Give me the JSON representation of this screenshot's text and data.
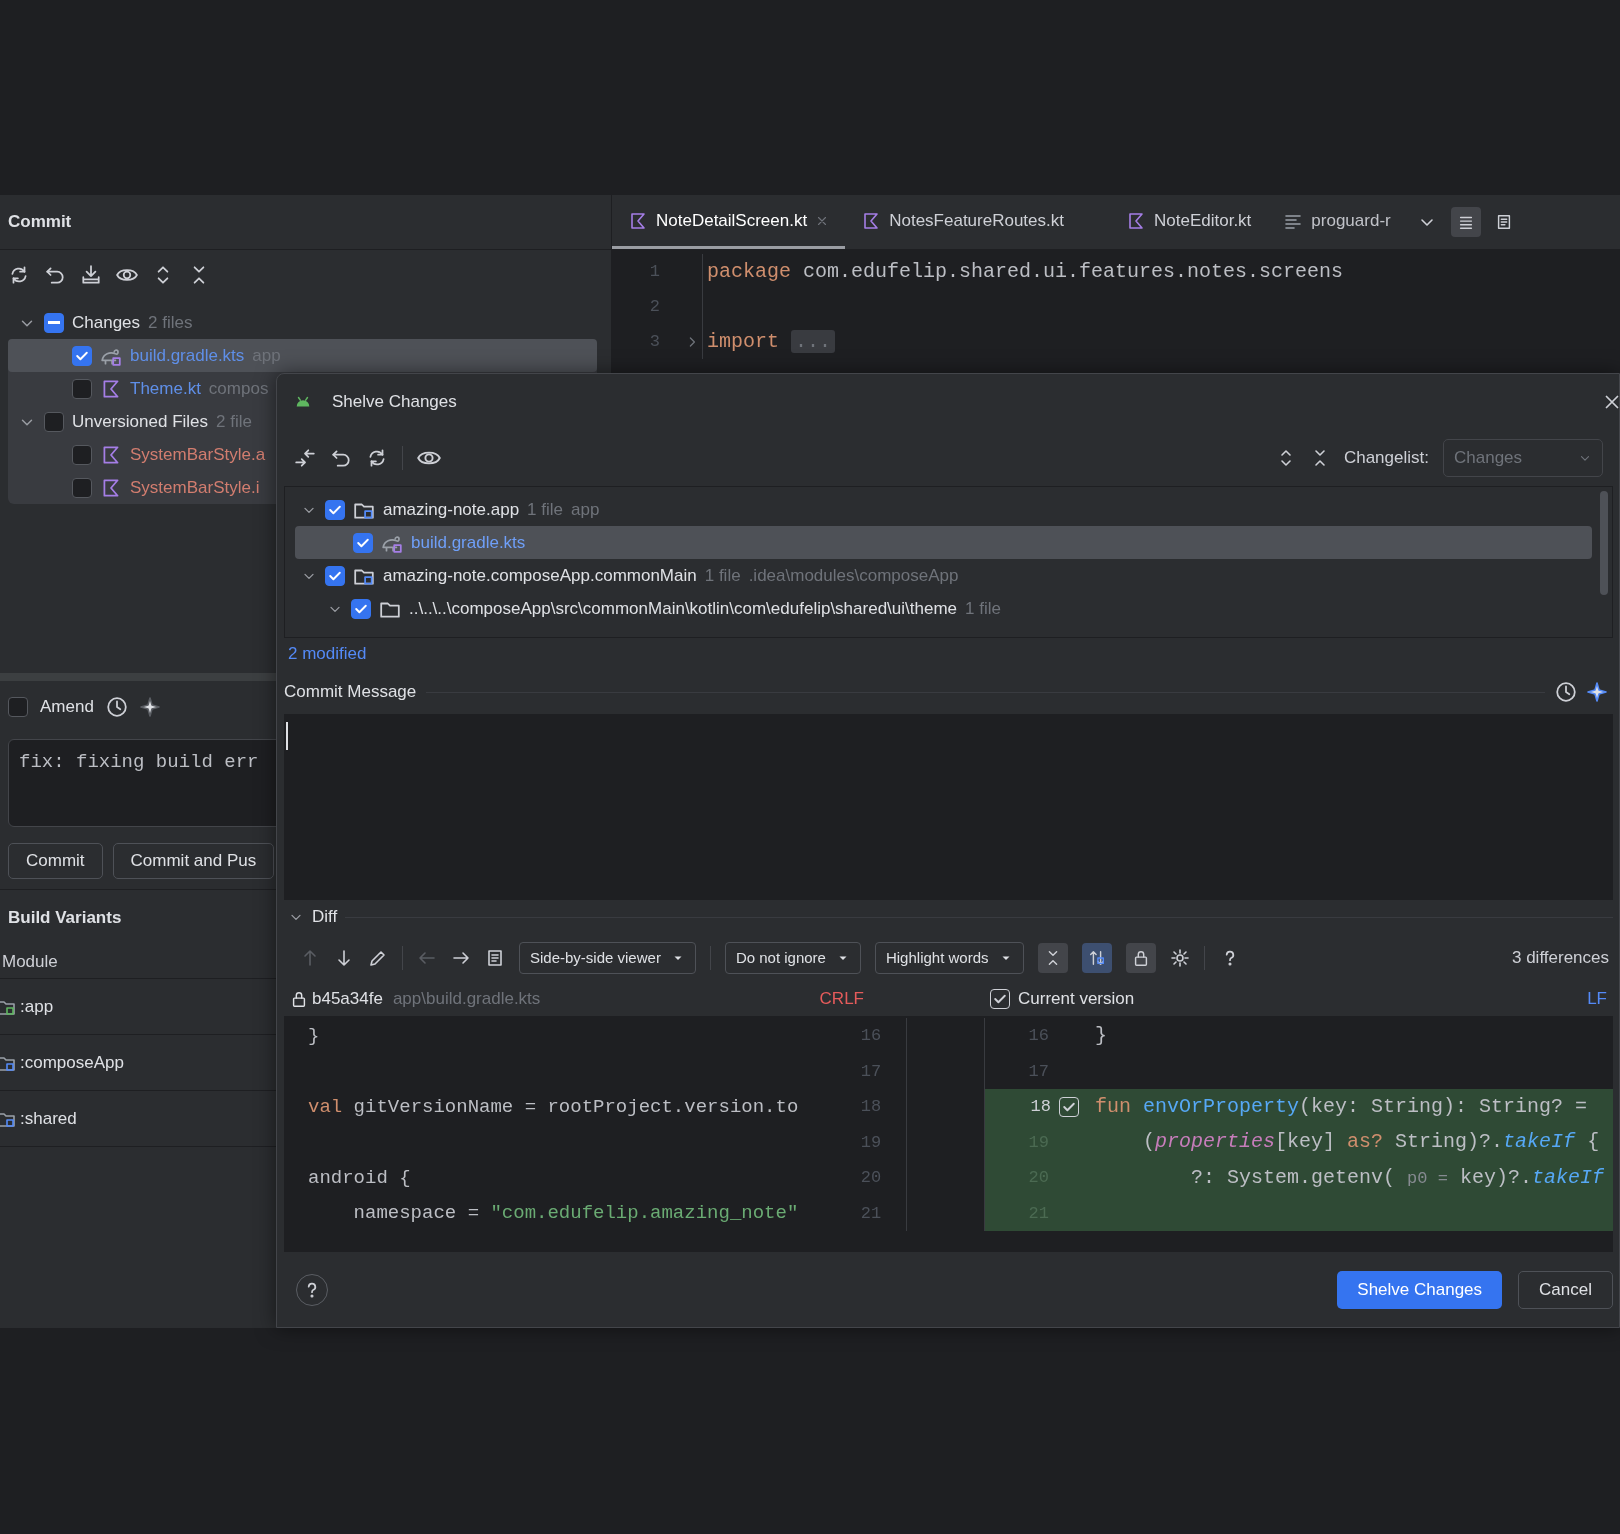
{
  "commit_panel": {
    "title": "Commit",
    "tree": [
      {
        "kind": "group",
        "label": "Changes",
        "meta": "2 files",
        "checked": false,
        "indeterminate": true,
        "selected": false,
        "children": [
          {
            "kind": "gradle-file",
            "label": "build.gradle.kts",
            "meta": "app",
            "color": "#5f8fe8",
            "checked": true,
            "indeterminate": false,
            "selected": true
          },
          {
            "kind": "kotlin-file",
            "label": "Theme.kt",
            "meta": "compos",
            "color": "#5f8fe8",
            "checked": false,
            "indeterminate": false,
            "selected": false
          }
        ]
      },
      {
        "kind": "group",
        "label": "Unversioned Files",
        "meta": "2 file",
        "checked": false,
        "indeterminate": false,
        "selected": false,
        "children": [
          {
            "kind": "kotlin-file",
            "label": "SystemBarStyle.a",
            "color": "#d27d6f",
            "checked": false,
            "indeterminate": false,
            "selected": false
          },
          {
            "kind": "kotlin-file",
            "label": "SystemBarStyle.i",
            "color": "#d27d6f",
            "checked": false,
            "indeterminate": false,
            "selected": false
          }
        ]
      }
    ],
    "amend": {
      "label": "Amend",
      "checked": false
    },
    "message": "fix: fixing build err",
    "buttons": [
      "Commit",
      "Commit and Pus"
    ]
  },
  "build_variants": {
    "title": "Build Variants",
    "column": "Module",
    "modules": [
      {
        "name": ":app",
        "kind": "application"
      },
      {
        "name": ":composeApp",
        "kind": "library"
      },
      {
        "name": ":shared",
        "kind": "library"
      }
    ]
  },
  "editor": {
    "tabs": [
      {
        "label": "NoteDetailScreen.kt",
        "kind": "kotlin",
        "selected": true,
        "closable": true
      },
      {
        "label": "NotesFeatureRoutes.kt",
        "kind": "kotlin",
        "selected": false,
        "closable": false
      },
      {
        "label": "NoteEditor.kt",
        "kind": "kotlin",
        "selected": false,
        "closable": false
      },
      {
        "label": "proguard-r",
        "kind": "text",
        "selected": false,
        "closable": false
      }
    ],
    "lines": [
      {
        "number": "1",
        "folded": false,
        "segments": [
          {
            "kind": "keyword",
            "text": "package"
          },
          {
            "kind": "plain",
            "text": " com.edufelip.shared.ui.features.notes.screens"
          }
        ]
      },
      {
        "number": "2",
        "folded": false
      },
      {
        "number": "3",
        "folded": true,
        "segments": [
          {
            "kind": "keyword",
            "text": "import"
          },
          {
            "kind": "fold",
            "text": "..."
          }
        ]
      }
    ]
  },
  "dialog": {
    "title": "Shelve Changes",
    "changelist_label": "Changelist:",
    "changelist": {
      "value": "Changes",
      "disabled": true
    },
    "tree": [
      {
        "kind": "module",
        "label": "amazing-note.app",
        "count": "1 file",
        "path": "app",
        "checked": true,
        "selected": false,
        "children": [
          {
            "kind": "gradle-file",
            "label": "build.gradle.kts",
            "checked": true,
            "selected": true
          }
        ]
      },
      {
        "kind": "module",
        "label": "amazing-note.composeApp.commonMain",
        "count": "1 file",
        "path": ".idea\\modules\\composeApp",
        "checked": true,
        "selected": false,
        "children": [
          {
            "kind": "folder",
            "label": "..\\..\\..\\composeApp\\src\\commonMain\\kotlin\\com\\edufelip\\shared\\ui\\theme",
            "count": "1 file",
            "checked": true,
            "selected": false
          }
        ]
      }
    ],
    "summary": "2 modified",
    "commit_message_label": "Commit Message",
    "diff": {
      "title": "Diff",
      "expanded": true,
      "viewer": "Side-by-side viewer",
      "ignore": "Do not ignore",
      "highlight": "Highlight words",
      "differences": "3 differences",
      "left": {
        "revision": "b45a34fe",
        "path": "app\\build.gradle.kts",
        "line_ending": "CRLF"
      },
      "right": {
        "label": "Current version",
        "checked": true,
        "line_ending": "LF"
      },
      "rows": [
        {
          "left_number": "16",
          "right_number": "16",
          "changed": false,
          "left": [
            {
              "kind": "plain",
              "text": "}"
            }
          ],
          "right": [
            {
              "kind": "plain",
              "text": "}"
            }
          ]
        },
        {
          "left_number": "17",
          "right_number": "17",
          "changed": false,
          "left": [],
          "right": []
        },
        {
          "left_number": "18",
          "right_number": "18",
          "changed": true,
          "selector": {
            "checked": true
          },
          "left": [
            {
              "kind": "keyword",
              "text": "val"
            },
            {
              "kind": "plain",
              "text": " gitVersionName = rootProject.version.to"
            }
          ],
          "right": [
            {
              "kind": "keyword",
              "text": "fun "
            },
            {
              "kind": "function",
              "text": "envOrProperty"
            },
            {
              "kind": "plain",
              "text": "(key: String): String? ="
            }
          ]
        },
        {
          "left_number": "19",
          "right_number": "19",
          "changed": true,
          "left": [],
          "right": [
            {
              "kind": "plain",
              "text": "    ("
            },
            {
              "kind": "property",
              "text": "properties"
            },
            {
              "kind": "plain",
              "text": "[key] "
            },
            {
              "kind": "keyword",
              "text": "as?"
            },
            {
              "kind": "plain",
              "text": " String)?."
            },
            {
              "kind": "call",
              "text": "takeIf"
            },
            {
              "kind": "plain",
              "text": " {"
            }
          ]
        },
        {
          "left_number": "20",
          "right_number": "20",
          "changed": true,
          "left": [
            {
              "kind": "plain",
              "text": "android {"
            }
          ],
          "right": [
            {
              "kind": "plain",
              "text": "        ?: System.getenv( "
            },
            {
              "kind": "hint",
              "text": "p0 ="
            },
            {
              "kind": "plain",
              "text": " key)?."
            },
            {
              "kind": "call",
              "text": "takeIf"
            }
          ]
        },
        {
          "left_number": "21",
          "right_number": "21",
          "changed": true,
          "left": [
            {
              "kind": "plain",
              "text": "    namespace = "
            },
            {
              "kind": "string",
              "text": "\"com.edufelip.amazing_note\""
            }
          ],
          "right": []
        }
      ]
    },
    "buttons": [
      {
        "label": "Shelve Changes",
        "primary": true
      },
      {
        "label": "Cancel",
        "primary": false
      }
    ]
  }
}
